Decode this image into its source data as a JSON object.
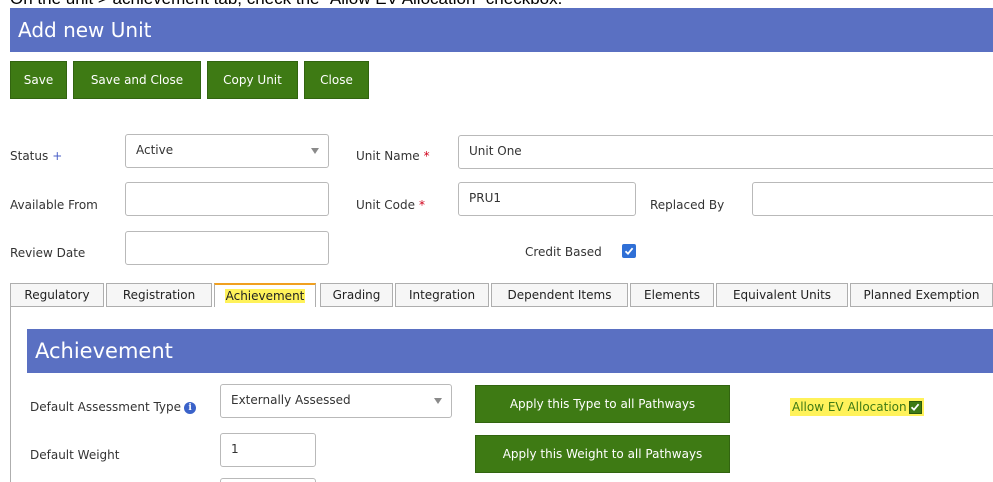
{
  "instruction": "On the unit > achievement tab, check the “Allow EV Allocation” checkbox.",
  "page_title": "Add new Unit",
  "toolbar": {
    "save": "Save",
    "save_and_close": "Save and Close",
    "copy_unit": "Copy Unit",
    "close": "Close"
  },
  "form": {
    "status_label": "Status",
    "status_required": "+",
    "status_value": "Active",
    "unit_name_label": "Unit Name",
    "unit_name_value": "Unit One",
    "available_from_label": "Available From",
    "available_from_value": "",
    "unit_code_label": "Unit Code",
    "unit_code_value": "PRU1",
    "replaced_by_label": "Replaced By",
    "replaced_by_value": "",
    "review_date_label": "Review Date",
    "review_date_value": "",
    "credit_based_label": "Credit Based",
    "credit_based_checked": true,
    "required_marker": "*"
  },
  "tabs": [
    {
      "label": "Regulatory",
      "active": false
    },
    {
      "label": "Registration",
      "active": false
    },
    {
      "label": "Achievement",
      "active": true
    },
    {
      "label": "Grading",
      "active": false
    },
    {
      "label": "Integration",
      "active": false
    },
    {
      "label": "Dependent Items",
      "active": false
    },
    {
      "label": "Elements",
      "active": false
    },
    {
      "label": "Equivalent Units",
      "active": false
    },
    {
      "label": "Planned Exemption",
      "active": false
    }
  ],
  "achievement": {
    "section_title": "Achievement",
    "default_assessment_type_label": "Default Assessment Type",
    "default_assessment_type_value": "Externally Assessed",
    "apply_type_button": "Apply this Type to all Pathways",
    "allow_ev_label": "Allow EV Allocation",
    "allow_ev_checked": true,
    "default_weight_label": "Default Weight",
    "default_weight_value": "1",
    "apply_weight_button": "Apply this Weight to all Pathways"
  },
  "colors": {
    "header_blue": "#5a70c2",
    "button_green": "#3e7a14",
    "highlight_yellow": "#fff25a",
    "checkbox_blue": "#2f6fd6"
  }
}
